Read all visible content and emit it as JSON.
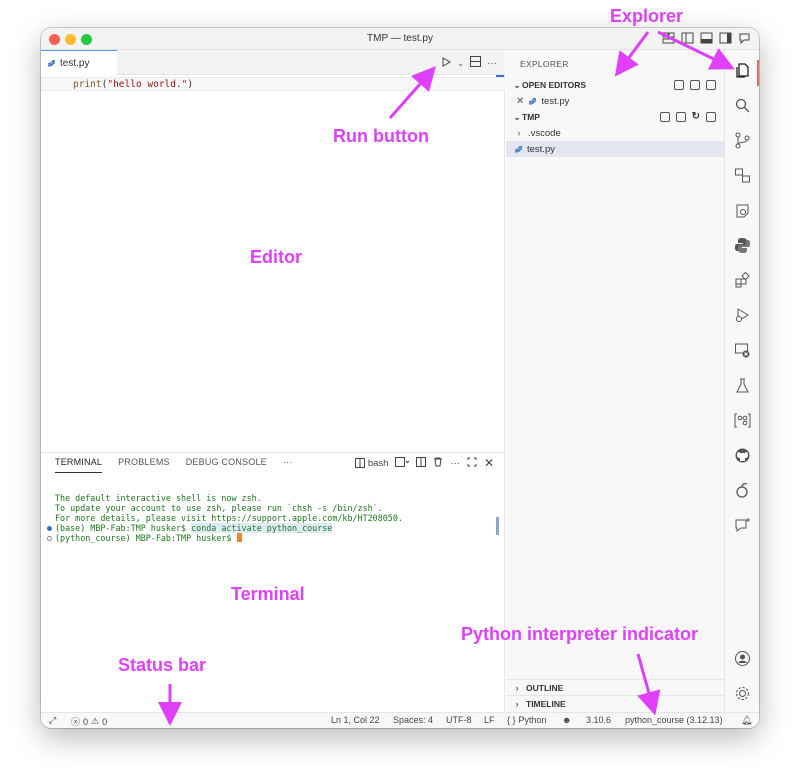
{
  "window": {
    "title": "TMP — test.py"
  },
  "editor": {
    "tab_label": "test.py",
    "code": {
      "fn": "print",
      "open": "(",
      "str": "\"hello world.\"",
      "close": ")"
    }
  },
  "panel": {
    "tabs": [
      "TERMINAL",
      "PROBLEMS",
      "DEBUG CONSOLE"
    ],
    "more": "···",
    "shell_label": "bash"
  },
  "terminal": {
    "lines": [
      "The default interactive shell is now zsh.",
      "To update your account to use zsh, please run `chsh -s /bin/zsh`.",
      "For more details, please visit https://support.apple.com/kb/HT208050."
    ],
    "prompt1": "(base) MBP-Fab:TMP husker$ ",
    "command1": "conda activate python_course",
    "prompt2": "(python_course) MBP-Fab:TMP husker$ "
  },
  "explorer": {
    "title": "EXPLORER",
    "open_editors_label": "OPEN EDITORS",
    "open_file": "test.py",
    "folder_label": "TMP",
    "items": [
      {
        "label": ".vscode",
        "kind": "folder"
      },
      {
        "label": "test.py",
        "kind": "file"
      }
    ],
    "outline_label": "OUTLINE",
    "timeline_label": "TIMELINE"
  },
  "status_bar": {
    "errors": "0",
    "warnings": "0",
    "position": "Ln 1, Col 22",
    "spaces": "Spaces: 4",
    "encoding": "UTF-8",
    "eol": "LF",
    "language": "Python",
    "python_version": "3.10.6",
    "interpreter": "python_course (3.12.13)"
  },
  "annotations": {
    "explorer": "Explorer",
    "run_button": "Run button",
    "editor": "Editor",
    "terminal": "Terminal",
    "python_interpreter": "Python interpreter indicator",
    "status_bar": "Status bar"
  },
  "colors": {
    "annotation": "#e040fb",
    "accent": "#3a6fd8",
    "activity_indicator": "#f06a5a",
    "terminal_text": "#1d7a1d",
    "cursor": "#f0852d"
  },
  "icons": {
    "activitybar": [
      "explorer-icon",
      "search-icon",
      "source-control-icon",
      "remote-explorer-icon",
      "run-debug-icon",
      "python-icon",
      "extensions-icon",
      "testing-run-icon",
      "remote-disconnect-icon",
      "flask-icon",
      "graph-icon",
      "github-icon",
      "copilot-icon",
      "chat-icon",
      "account-icon",
      "settings-gear-icon"
    ]
  }
}
